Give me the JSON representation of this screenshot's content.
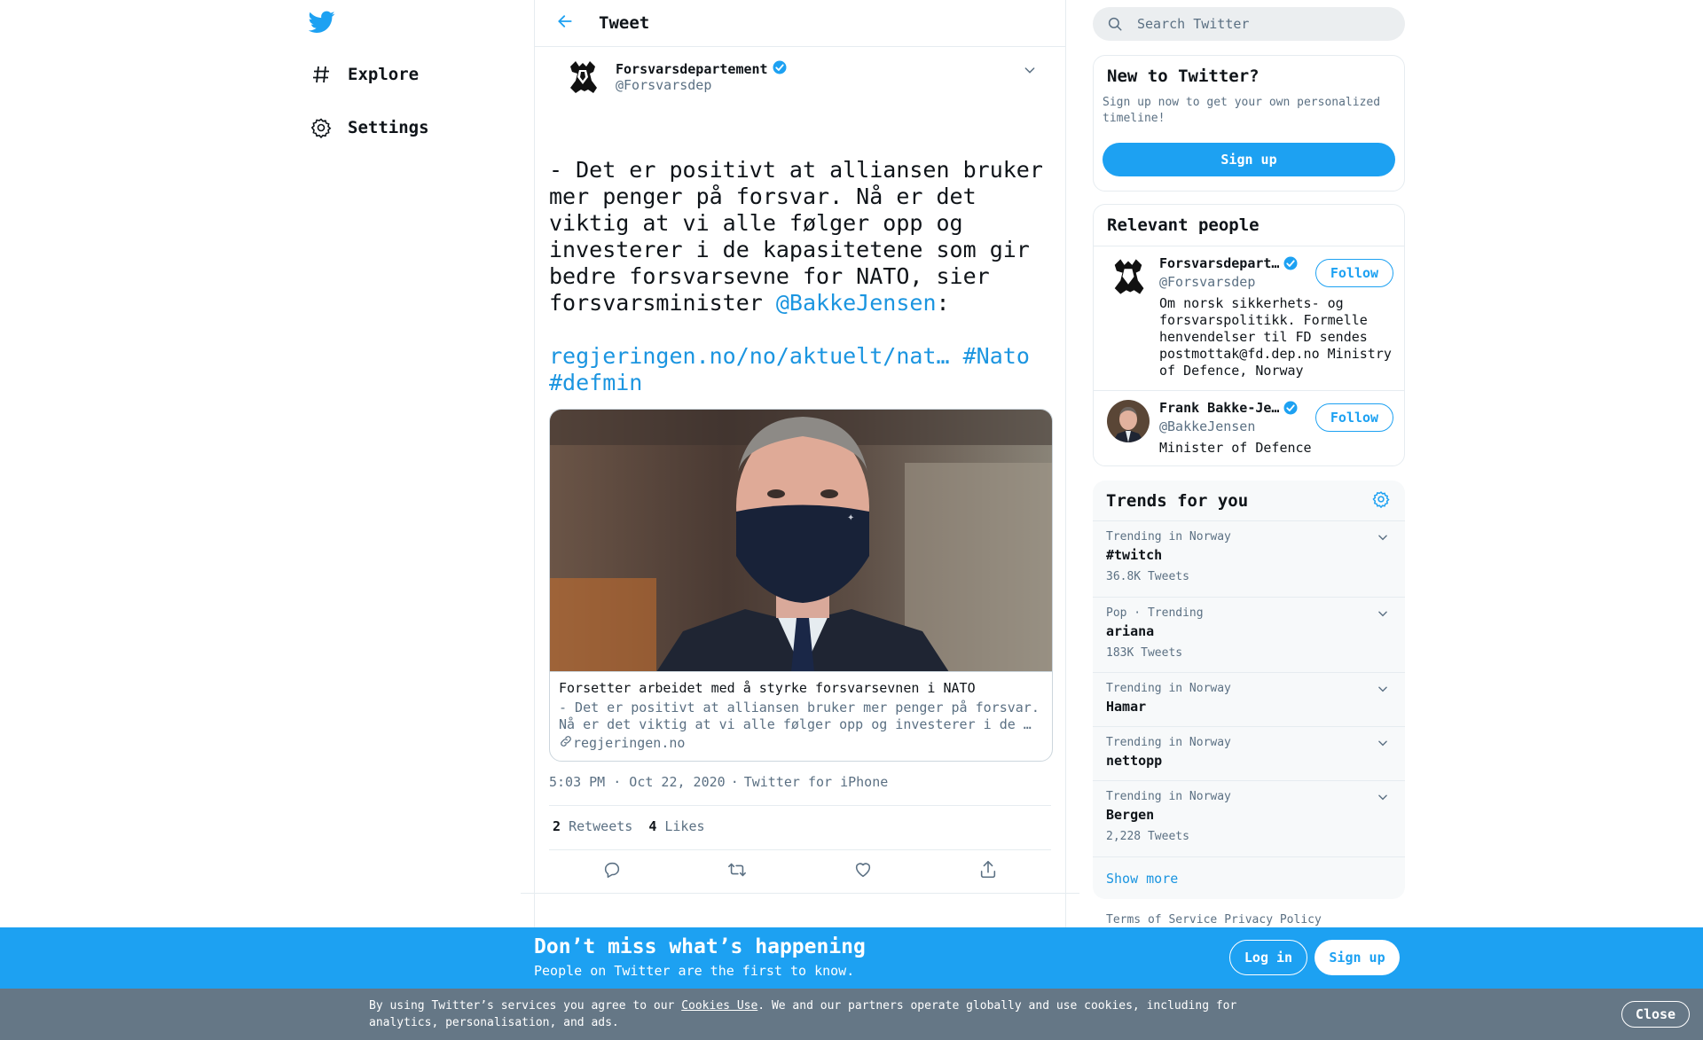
{
  "nav": {
    "explore_label": "Explore",
    "settings_label": "Settings"
  },
  "header": {
    "title": "Tweet"
  },
  "tweet": {
    "author_name": "Forsvarsdepartement",
    "author_handle": "@Forsvarsdep",
    "text_part1": "- Det er positivt at alliansen bruker mer penger på forsvar. Nå er det viktig at vi alle følger opp og investerer i de kapasitetene som gir bedre forsvarsevne for NATO, sier forsvarsminister ",
    "mention": "@BakkeJensen",
    "text_colon": ":",
    "link": "regjeringen.no/no/aktuelt/nat…",
    "hashtag1": "#Nato",
    "hashtag2": "#defmin",
    "card": {
      "title": "Forsetter arbeidet med å styrke forsvarsevnen i NATO",
      "description": "- Det er positivt at alliansen bruker mer penger på forsvar. Nå er det viktig at vi alle følger opp og investerer i de …",
      "domain": "regjeringen.no"
    },
    "time": "5:03 PM · Oct 22, 2020",
    "separator": "·",
    "source": "Twitter for iPhone",
    "retweets_count": "2",
    "retweets_label": "Retweets",
    "likes_count": "4",
    "likes_label": "Likes"
  },
  "search": {
    "placeholder": "Search Twitter"
  },
  "new_to_twitter": {
    "title": "New to Twitter?",
    "subtitle": "Sign up now to get your own personalized timeline!",
    "button": "Sign up"
  },
  "relevant_people": {
    "title": "Relevant people",
    "people": [
      {
        "name": "Forsvarsdepart…",
        "handle": "@Forsvarsdep",
        "bio": "Om norsk sikkerhets- og forsvarspolitikk. Formelle henvendelser til FD sendes postmottak@fd.dep.no Ministry of Defence, Norway",
        "follow": "Follow"
      },
      {
        "name": "Frank Bakke-Je…",
        "handle": "@BakkeJensen",
        "bio": "Minister of Defence",
        "follow": "Follow"
      }
    ]
  },
  "trends": {
    "title": "Trends for you",
    "items": [
      {
        "context": "Trending in Norway",
        "name": "#twitch",
        "count": "36.8K Tweets"
      },
      {
        "context": "Pop · Trending",
        "name": "ariana",
        "count": "183K Tweets"
      },
      {
        "context": "Trending in Norway",
        "name": "Hamar",
        "count": ""
      },
      {
        "context": "Trending in Norway",
        "name": "nettopp",
        "count": ""
      },
      {
        "context": "Trending in Norway",
        "name": "Bergen",
        "count": "2,228 Tweets"
      }
    ],
    "show_more": "Show more"
  },
  "footer": {
    "terms": "Terms of Service",
    "privacy": "Privacy Policy"
  },
  "signup_bar": {
    "title": "Don’t miss what’s happening",
    "subtitle": "People on Twitter are the first to know.",
    "login": "Log in",
    "signup": "Sign up"
  },
  "cookie_bar": {
    "text_before": "By using Twitter’s services you agree to our ",
    "link": "Cookies Use",
    "text_after": ". We and our partners operate globally and use cookies, including for analytics, personalisation, and ads.",
    "close": "Close"
  },
  "colors": {
    "brand_blue": "#1da1f2",
    "link_blue": "#1b95e0",
    "secondary_text": "#5b7083",
    "cookie_gray": "#657786"
  },
  "icons": {
    "logo": "twitter-bird-icon",
    "explore": "hashtag-icon",
    "settings": "gear-icon",
    "back": "arrow-left-icon",
    "verified": "verified-badge-icon",
    "caret": "chevron-down-icon",
    "reply": "reply-icon",
    "retweet": "retweet-icon",
    "like": "heart-icon",
    "share": "share-icon",
    "search": "search-icon",
    "link": "link-icon"
  }
}
